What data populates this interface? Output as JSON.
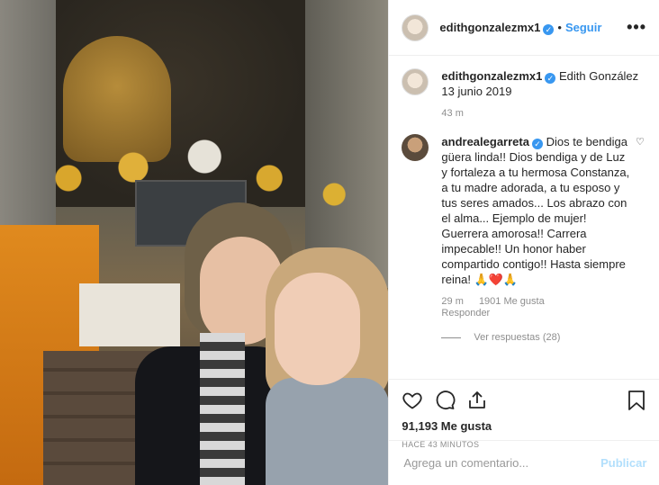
{
  "header": {
    "username": "edithgonzalezmx1",
    "verified": "✓",
    "separator": "•",
    "follow_label": "Seguir",
    "more_icon": "more-horizontal-icon"
  },
  "caption": {
    "username": "edithgonzalezmx1",
    "verified": "✓",
    "text": "Edith González 13 junio 2019",
    "time": "43 m"
  },
  "comments": [
    {
      "username": "andrealegarreta",
      "verified": "✓",
      "text": "Dios te bendiga güera linda!! Dios bendiga y de Luz y fortaleza a tu hermosa Constanza, a tu madre adorada, a tu esposo y tus seres amados... Los abrazo con el alma... Ejemplo de mujer! Guerrera amorosa!! Carrera impecable!! Un honor haber compartido contigo!! Hasta siempre reina! 🙏❤️🙏",
      "time": "29 m",
      "likes": "1901 Me gusta",
      "reply_label": "Responder",
      "view_replies": "Ver respuestas (28)"
    }
  ],
  "actions": {
    "like_count": "91,193 Me gusta",
    "time_ago": "HACE 43 MINUTOS"
  },
  "add_comment": {
    "placeholder": "Agrega un comentario...",
    "publish_label": "Publicar"
  },
  "colors": {
    "accent": "#3897f0",
    "muted": "#8e8e8e",
    "publish_disabled": "#b2dffc"
  }
}
